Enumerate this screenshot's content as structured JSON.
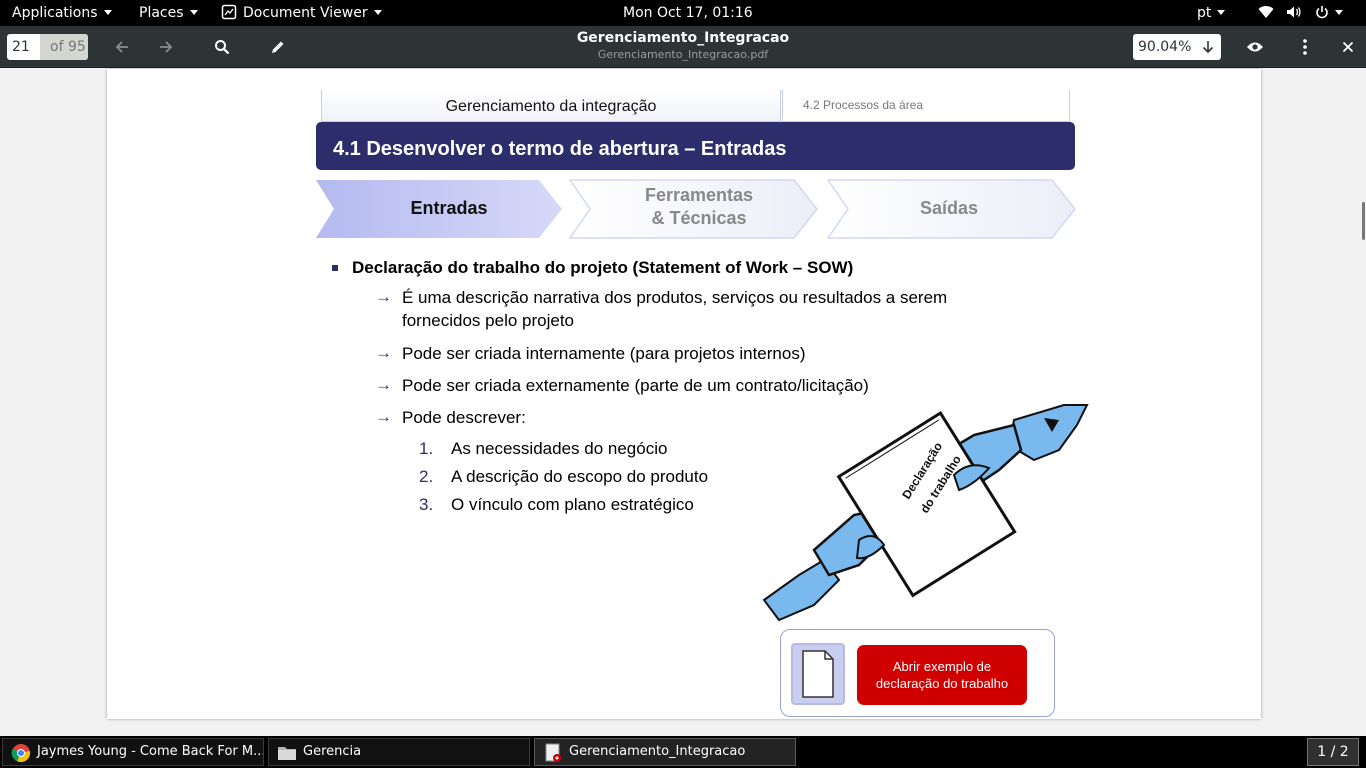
{
  "topbar": {
    "applications": "Applications",
    "places": "Places",
    "app_name": "Document Viewer",
    "clock": "Mon Oct 17, 01:16",
    "language": "pt"
  },
  "toolbar": {
    "current_page": "21",
    "total_pages": "of 95",
    "title": "Gerenciamento_Integracao",
    "filename": "Gerenciamento_Integracao.pdf",
    "zoom": "90.04%"
  },
  "slide": {
    "tab_left": "Gerenciamento da integração",
    "tab_right": "4.2 Processos da área",
    "banner": "4.1 Desenvolver o termo de abertura – Entradas",
    "stages": {
      "entradas": "Entradas",
      "ferramentas_line1": "Ferramentas",
      "ferramentas_line2": "& Técnicas",
      "saidas": "Saídas"
    },
    "main_bullet": "Declaração do trabalho do projeto (Statement of Work – SOW)",
    "arrow_items": [
      "É uma descrição  narrativa dos produtos, serviços ou resultados a serem fornecidos pelo projeto",
      "Pode ser criada internamente (para projetos internos)",
      "Pode ser criada externamente (parte de um contrato/licitação)",
      "Pode descrever:"
    ],
    "numbered_items": [
      {
        "num": "1.",
        "text": "As necessidades do negócio"
      },
      {
        "num": "2.",
        "text": "A descrição do escopo do produto"
      },
      {
        "num": "3.",
        "text": "O vínculo com plano estratégico"
      }
    ],
    "illustration_text_line1": "Declaração",
    "illustration_text_line2": "do trabalho",
    "cta_button": "Abrir exemplo de declaração do trabalho"
  },
  "taskbar": {
    "tasks": [
      {
        "label": "Jaymes Young - Come Back For M...",
        "icon": "chrome-icon"
      },
      {
        "label": "Gerencia",
        "icon": "folder-icon"
      },
      {
        "label": "Gerenciamento_Integracao",
        "icon": "document-viewer-icon"
      }
    ],
    "workspace": "1 / 2"
  },
  "colors": {
    "banner": "#2b2e6b",
    "accent_red": "#d10000",
    "chevron_active": "#c9cdf5",
    "hand_blue": "#79b9ee"
  }
}
